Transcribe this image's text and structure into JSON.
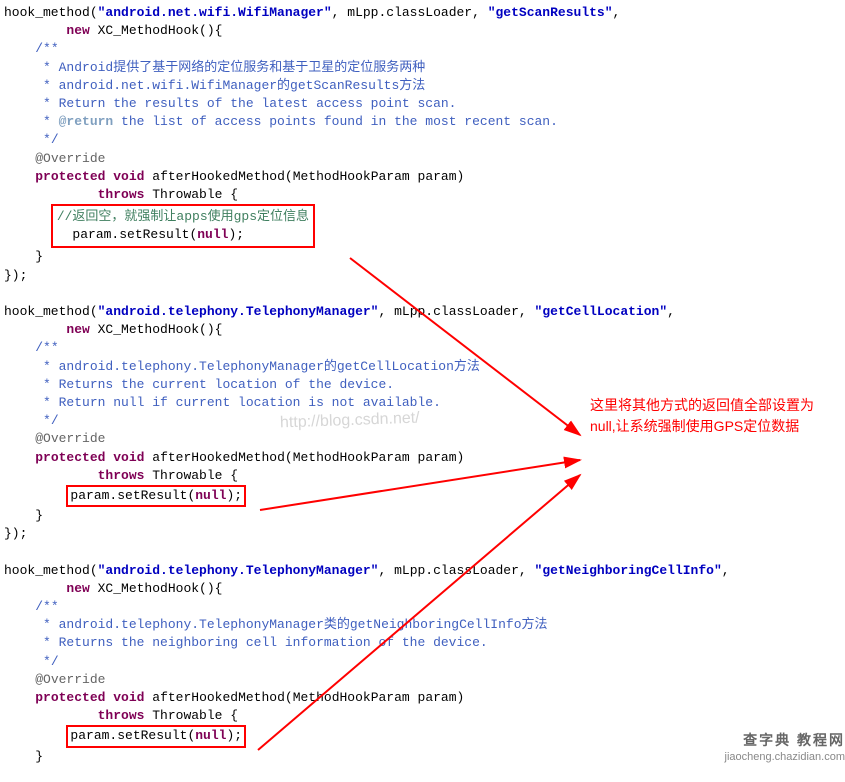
{
  "code": {
    "block1": {
      "hook": "hook_method(",
      "arg1": "\"android.net.wifi.WifiManager\"",
      "sep1": ", mLpp.classLoader, ",
      "arg3": "\"getScanResults\"",
      "tail": ",",
      "new": "new",
      "xc": " XC_MethodHook(){",
      "doc1": "/**",
      "doc2": " * Android提供了基于网络的定位服务和基于卫星的定位服务两种",
      "doc3": " * android.net.wifi.WifiManager的getScanResults方法",
      "doc4": " * Return the results of the latest access point scan.",
      "doc5a": " * ",
      "doc5tag": "@return",
      "doc5b": " the list of access points found in the most recent scan.",
      "doc6": " */",
      "override": "@Override",
      "prot": "protected",
      "void": "void",
      "method": " afterHookedMethod(MethodHookParam param)",
      "throws": "throws",
      "throwable": " Throwable {",
      "boxed_line1": "//返回空，就强制让apps使用gps定位信息",
      "boxed_line2a": "param.setResult(",
      "boxed_null": "null",
      "boxed_line2b": ");",
      "close1": "    }",
      "close2": "});"
    },
    "block2": {
      "hook": "hook_method(",
      "arg1": "\"android.telephony.TelephonyManager\"",
      "sep1": ", mLpp.classLoader, ",
      "arg3": "\"getCellLocation\"",
      "tail": ",",
      "new": "new",
      "xc": " XC_MethodHook(){",
      "doc1": "/**",
      "doc2": " * android.telephony.TelephonyManager的getCellLocation方法",
      "doc3": " * Returns the current location of the device.",
      "doc4": " * Return null if current location is not available.",
      "doc6": " */",
      "override": "@Override",
      "prot": "protected",
      "void": "void",
      "method": " afterHookedMethod(MethodHookParam param)",
      "throws": "throws",
      "throwable": " Throwable {",
      "boxed_line2a": "param.setResult(",
      "boxed_null": "null",
      "boxed_line2b": ");",
      "close1": "    }",
      "close2": "});"
    },
    "block3": {
      "hook": "hook_method(",
      "arg1": "\"android.telephony.TelephonyManager\"",
      "sep1": ", mLpp.classLoader, ",
      "arg3": "\"getNeighboringCellInfo\"",
      "tail": ",",
      "new": "new",
      "xc": " XC_MethodHook(){",
      "doc1": "/**",
      "doc2": " * android.telephony.TelephonyManager类的getNeighboringCellInfo方法",
      "doc3": " * Returns the neighboring cell information of the device.",
      "doc6": " */",
      "override": "@Override",
      "prot": "protected",
      "void": "void",
      "method": " afterHookedMethod(MethodHookParam param)",
      "throws": "throws",
      "throwable": " Throwable {",
      "boxed_line2a": "param.setResult(",
      "boxed_null": "null",
      "boxed_line2b": ");",
      "close1": "    }"
    }
  },
  "annotation": {
    "line1": "这里将其他方式的返回值全部设置为",
    "line2": "null,让系统强制使用GPS定位数据"
  },
  "watermark": "http://blog.csdn.net/",
  "footer": {
    "title": "查字典 教程网",
    "url": "jiaocheng.chazidian.com"
  }
}
